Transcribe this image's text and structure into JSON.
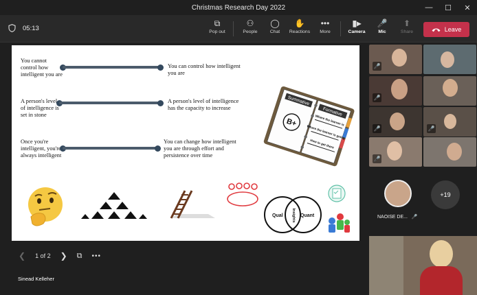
{
  "window": {
    "title": "Christmas Research Day 2022",
    "controls": [
      "—",
      "☐",
      "✕"
    ]
  },
  "toolbar": {
    "timer": "05:13",
    "pop_out": "Pop out",
    "people": "People",
    "chat": "Chat",
    "reactions": "Reactions",
    "more": "More",
    "camera": "Camera",
    "mic": "Mic",
    "share": "Share",
    "leave": "Leave"
  },
  "slide": {
    "rows": [
      {
        "left": "You cannot control how intelligent you are",
        "right": "You can control how intelligent you are"
      },
      {
        "left": "A person's level of intelligence is set in stone",
        "right": "A person's level of intelligence has the capacity to increase"
      },
      {
        "left": "Once you're intelligent, you're always intelligent",
        "right": "You can change how intelligent you are through effort and persistence over time"
      }
    ],
    "book": {
      "left_tab": "Summative",
      "grade": "B+",
      "right_tab": "Formative",
      "lines": [
        "Where the learner is",
        "Where the learner is going",
        "How to get there"
      ]
    },
    "venn": {
      "left": "Qual",
      "center": "Insights",
      "right": "Quant"
    }
  },
  "pager": {
    "text": "1 of 2"
  },
  "presenter_name": "Sinead Kelleher",
  "participants": {
    "named_label": "NAOISE DE...",
    "named_initials": "",
    "overflow_count": "+19"
  },
  "colors": {
    "leave": "#c4314b",
    "bar": "#4b5b6b",
    "background": "#1f1f1f"
  }
}
